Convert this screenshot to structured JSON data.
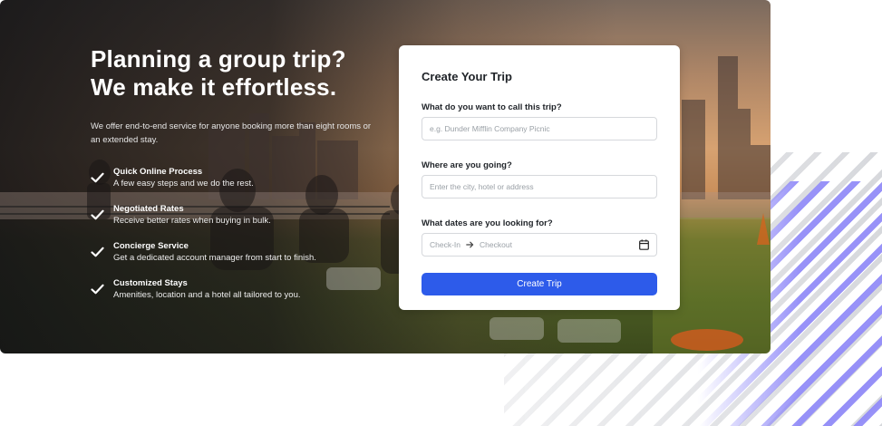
{
  "hero": {
    "headline_line1": "Planning a group trip?",
    "headline_line2": "We make it effortless.",
    "subtext": "We offer end-to-end service for anyone booking more than eight rooms or an extended stay.",
    "features": [
      {
        "title": "Quick Online Process",
        "desc": "A few easy steps and we do the rest.",
        "icon": "check-icon"
      },
      {
        "title": "Negotiated Rates",
        "desc": "Receive better rates when buying in bulk.",
        "icon": "check-icon"
      },
      {
        "title": "Concierge Service",
        "desc": "Get a dedicated account manager from start to finish.",
        "icon": "check-icon"
      },
      {
        "title": "Customized Stays",
        "desc": "Amenities, location and a hotel all tailored to you.",
        "icon": "check-icon"
      }
    ]
  },
  "form": {
    "title": "Create Your Trip",
    "trip_name": {
      "label": "What do you want to call this trip?",
      "placeholder": "e.g. Dunder Mifflin Company Picnic",
      "value": ""
    },
    "destination": {
      "label": "Where are you going?",
      "placeholder": "Enter the city, hotel or address",
      "value": ""
    },
    "dates": {
      "label": "What dates are you looking for?",
      "checkin_placeholder": "Check-In",
      "checkout_placeholder": "Checkout",
      "icon": "calendar-icon"
    },
    "submit_label": "Create Trip"
  },
  "colors": {
    "accent": "#2d5bea",
    "stripe_gray": "#cdcfd4",
    "stripe_purple": "#928cf8"
  }
}
